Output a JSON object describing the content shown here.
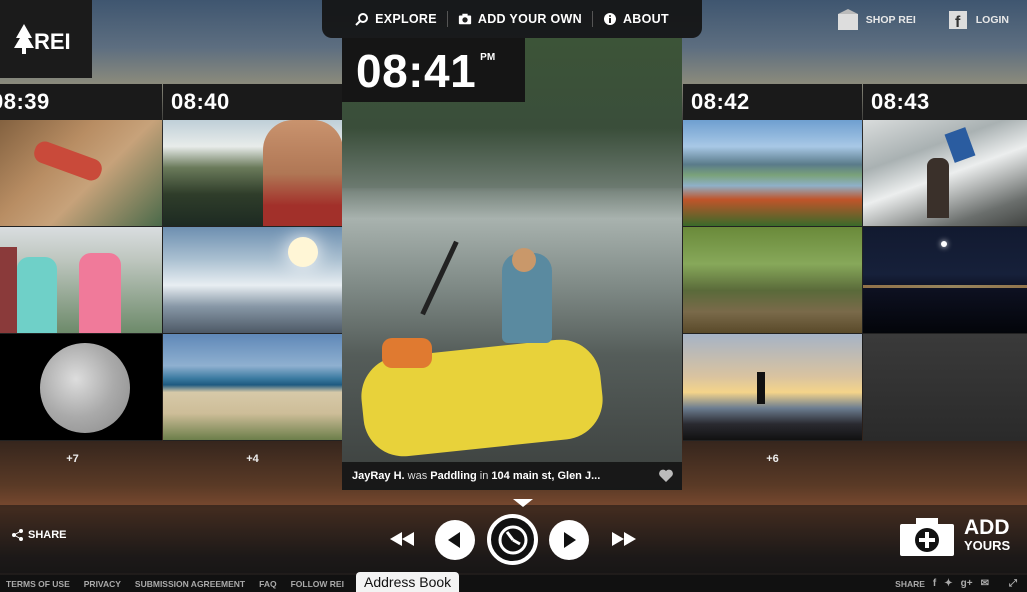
{
  "brand": {
    "name": "REI"
  },
  "nav": {
    "explore": "EXPLORE",
    "add_your_own": "ADD YOUR OWN",
    "about": "ABOUT"
  },
  "header_links": {
    "shop": "SHOP REI",
    "login": "LOGIN"
  },
  "columns": [
    {
      "time": "08:39",
      "more": "+7"
    },
    {
      "time": "08:40",
      "more": "+4"
    },
    {
      "time": "08:42",
      "more": "+6"
    },
    {
      "time": "08:43",
      "more": ""
    }
  ],
  "featured": {
    "time": "08:41",
    "ampm": "PM",
    "caption": {
      "user": "JayRay H.",
      "was": "was",
      "activity": "Paddling",
      "in": "in",
      "place": "104 main st, Glen J..."
    }
  },
  "controls": {
    "share": "SHARE",
    "add": "ADD",
    "yours": "YOURS"
  },
  "footer": {
    "links": [
      "TERMS OF USE",
      "PRIVACY",
      "SUBMISSION AGREEMENT",
      "FAQ",
      "FOLLOW REI"
    ],
    "tooltip": "Address Book",
    "share_label": "SHARE"
  },
  "colors": {
    "bar": "#1a1a1a",
    "accent_white": "#ffffff"
  }
}
